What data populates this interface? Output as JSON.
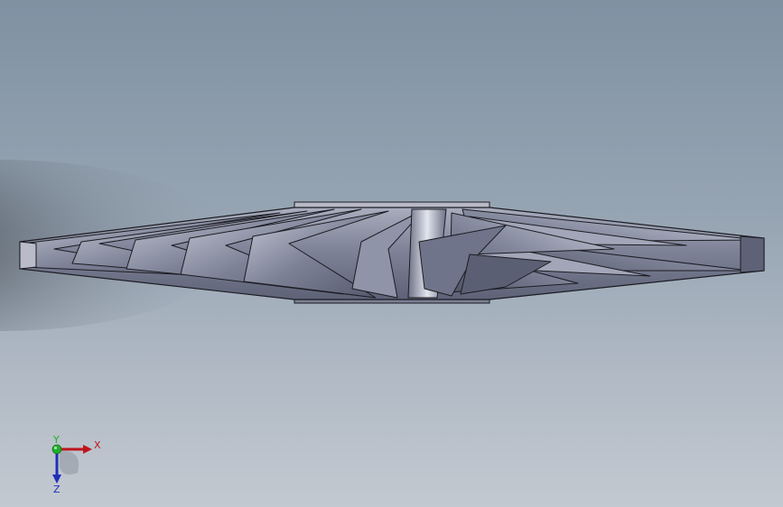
{
  "viewport": {
    "background_top": "#7f91a2",
    "background_bottom": "#c3c9d1"
  },
  "model": {
    "name": "impeller-side-view",
    "body_color": "#8a8fa4",
    "edge_color": "#1c1c22",
    "highlight_color": "#d6d8e2",
    "shadow_color": "#4d5566"
  },
  "triad": {
    "x_label": "X",
    "y_label": "Y",
    "z_label": "Z",
    "x_color": "#c0141c",
    "y_color": "#1fae2a",
    "z_color": "#1f2fb8"
  }
}
